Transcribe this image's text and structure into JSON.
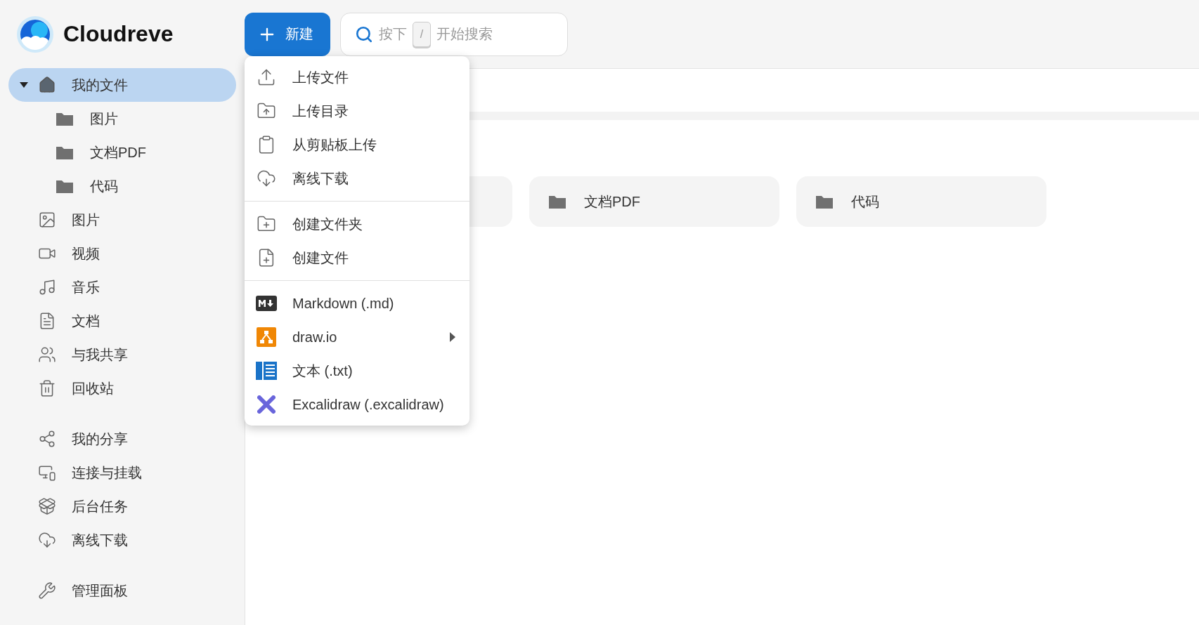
{
  "app": {
    "name": "Cloudreve"
  },
  "new_button": {
    "label": "新建"
  },
  "search": {
    "hint_before": "按下",
    "key": "/",
    "hint_after": "开始搜索"
  },
  "sidebar": {
    "sections": [
      [
        {
          "label": "我的文件",
          "selected": true,
          "expanded": true,
          "children": [
            {
              "label": "图片"
            },
            {
              "label": "文档PDF"
            },
            {
              "label": "代码"
            }
          ]
        },
        {
          "label": "图片",
          "selected": false
        },
        {
          "label": "视频",
          "selected": false
        },
        {
          "label": "音乐",
          "selected": false
        },
        {
          "label": "文档",
          "selected": false
        },
        {
          "label": "与我共享",
          "selected": false
        },
        {
          "label": "回收站",
          "selected": false
        }
      ],
      [
        {
          "label": "我的分享",
          "selected": false
        },
        {
          "label": "连接与挂载",
          "selected": false
        },
        {
          "label": "后台任务",
          "selected": false
        },
        {
          "label": "离线下载",
          "selected": false
        }
      ],
      [
        {
          "label": "管理面板",
          "selected": false
        }
      ]
    ]
  },
  "new_menu": {
    "groups": [
      [
        {
          "label": "上传文件",
          "kind": "icon"
        },
        {
          "label": "上传目录",
          "kind": "icon"
        },
        {
          "label": "从剪贴板上传",
          "kind": "icon"
        },
        {
          "label": "离线下载",
          "kind": "icon"
        }
      ],
      [
        {
          "label": "创建文件夹",
          "kind": "icon"
        },
        {
          "label": "创建文件",
          "kind": "icon"
        }
      ],
      [
        {
          "label": "Markdown (.md)",
          "kind": "markdown",
          "has_submenu": false
        },
        {
          "label": "draw.io",
          "kind": "drawio",
          "has_submenu": true
        },
        {
          "label": "文本 (.txt)",
          "kind": "text",
          "has_submenu": false
        },
        {
          "label": "Excalidraw (.excalidraw)",
          "kind": "excalidraw",
          "has_submenu": false
        }
      ]
    ]
  },
  "folders": [
    {
      "name": "文档PDF"
    },
    {
      "name": "代码"
    }
  ]
}
